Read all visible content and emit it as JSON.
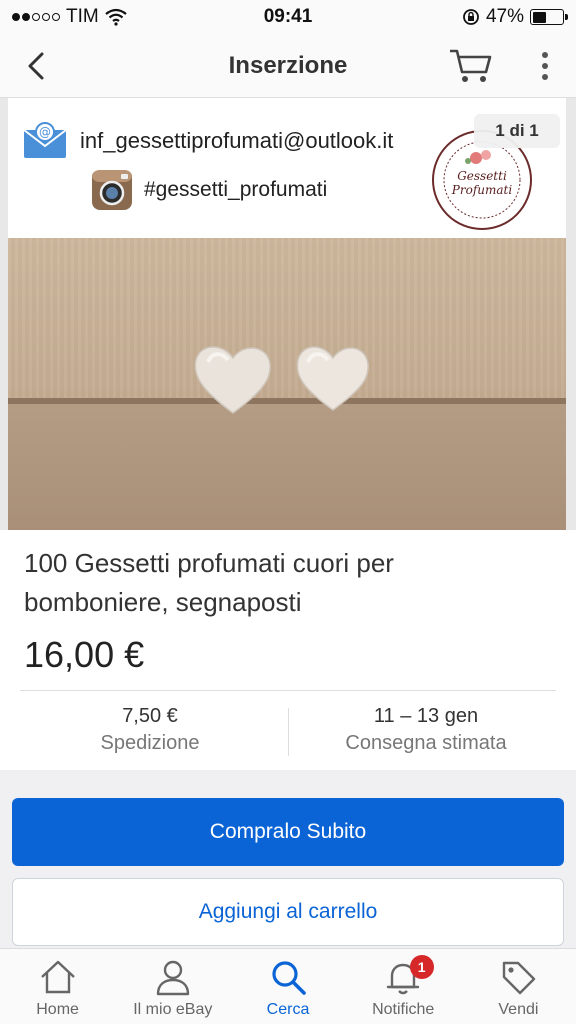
{
  "status_bar": {
    "carrier": "TIM",
    "time": "09:41",
    "battery_percent": "47%",
    "battery_level": 0.47
  },
  "nav": {
    "title": "Inserzione"
  },
  "gallery": {
    "email": "inf_gessettiprofumati@outlook.it",
    "instagram": "#gessetti_profumati",
    "counter": "1 di 1",
    "logo_text": "Gessetti Profumati"
  },
  "item": {
    "title": "100 Gessetti profumati cuori per bomboniere, segnaposti",
    "price": "16,00 €",
    "shipping_value": "7,50 €",
    "shipping_label": "Spedizione",
    "delivery_value": "11 – 13 gen",
    "delivery_label": "Consegna stimata"
  },
  "actions": {
    "buy_now": "Compralo Subito",
    "add_to_cart": "Aggiungi al carrello"
  },
  "tabs": [
    {
      "label": "Home",
      "icon": "home-icon"
    },
    {
      "label": "Il mio eBay",
      "icon": "user-icon"
    },
    {
      "label": "Cerca",
      "icon": "search-icon",
      "active": true
    },
    {
      "label": "Notifiche",
      "icon": "bell-icon",
      "badge": "1"
    },
    {
      "label": "Vendi",
      "icon": "tag-icon"
    }
  ],
  "colors": {
    "accent": "#0b64d6",
    "badge": "#d62828"
  }
}
